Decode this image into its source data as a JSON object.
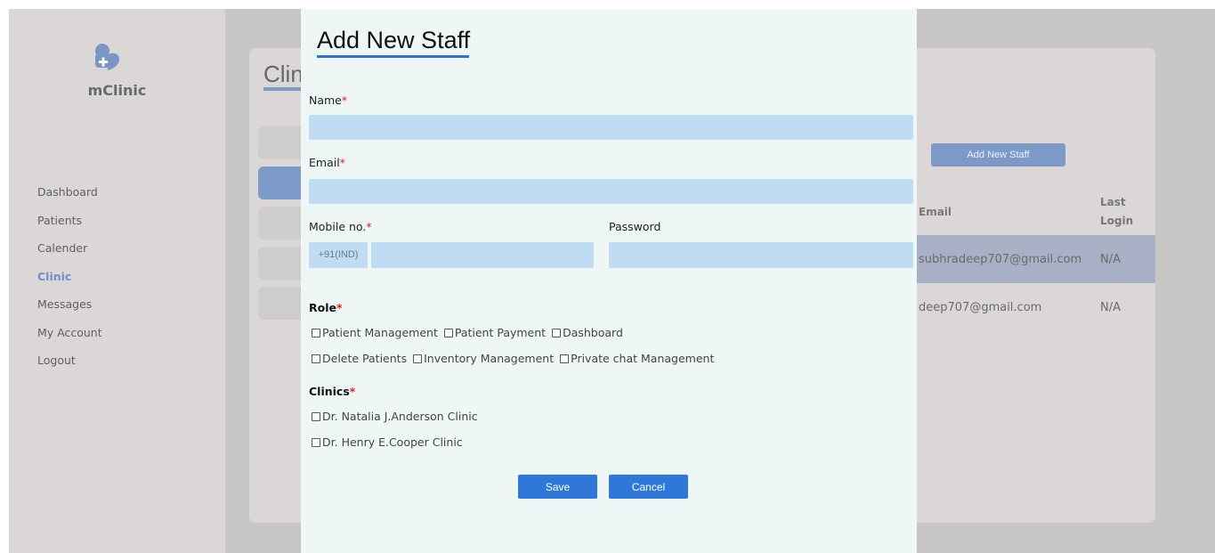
{
  "app": {
    "brand": "mClinic"
  },
  "sidebar": {
    "items": [
      {
        "label": "Dashboard"
      },
      {
        "label": "Patients"
      },
      {
        "label": "Calender"
      },
      {
        "label": "Clinic",
        "active": true
      },
      {
        "label": "Messages"
      },
      {
        "label": "My Account"
      },
      {
        "label": "Logout"
      }
    ]
  },
  "background": {
    "title": "Clin",
    "add_staff_label": "Add New Staff",
    "columns": {
      "email": "Email",
      "last_login_1": "Last",
      "last_login_2": "Login"
    },
    "rows": [
      {
        "email": "subhradeep707@gmail.com",
        "last_login": "N/A"
      },
      {
        "email": "deep707@gmail.com",
        "last_login": "N/A"
      }
    ]
  },
  "modal": {
    "title": "Add New Staff",
    "name_label": "Name",
    "email_label": "Email",
    "mobile_label": "Mobile no.",
    "mobile_prefix": "+91(IND)",
    "password_label": "Password",
    "required_mark": "*",
    "role_heading": "Role",
    "roles_row1": [
      "Patient Management",
      "Patient Payment",
      "Dashboard"
    ],
    "roles_row2": [
      "Delete Patients",
      "Inventory Management",
      "Private chat Management"
    ],
    "clinics_heading": "Clinics",
    "clinics": [
      "Dr. Natalia J.Anderson Clinic",
      "Dr. Henry E.Cooper Clinic"
    ],
    "save_label": "Save",
    "cancel_label": "Cancel"
  },
  "colors": {
    "accent": "#2f78d9",
    "input_bg": "#bfdcf2",
    "required": "#e02020",
    "sidebar_active": "#6f8fcf"
  },
  "icons": {
    "logo": "clinic-logo-icon"
  }
}
